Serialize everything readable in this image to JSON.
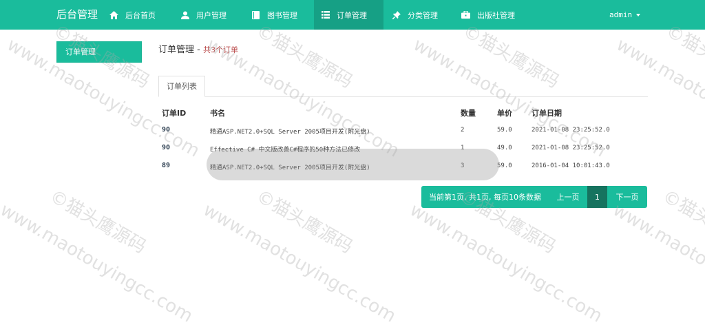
{
  "navbar": {
    "brand": "后台管理",
    "items": [
      {
        "label": "后台首页",
        "icon": "home-icon"
      },
      {
        "label": "用户管理",
        "icon": "user-icon"
      },
      {
        "label": "图书管理",
        "icon": "book-icon"
      },
      {
        "label": "订单管理",
        "icon": "list-icon"
      },
      {
        "label": "分类管理",
        "icon": "pushpin-icon"
      },
      {
        "label": "出版社管理",
        "icon": "briefcase-icon"
      }
    ],
    "user": "admin"
  },
  "sidebar": {
    "items": [
      {
        "label": "订单管理"
      }
    ]
  },
  "page": {
    "title": "订单管理 - ",
    "count": "共3个订单"
  },
  "tabs": [
    {
      "label": "订单列表"
    }
  ],
  "table": {
    "headers": [
      "订单ID",
      "书名",
      "数量",
      "单价",
      "订单日期"
    ],
    "rows": [
      {
        "id": "90",
        "name": "精通ASP.NET2.0+SQL Server 2005项目开发(附光盘)",
        "qty": "2",
        "price": "59.0",
        "date": "2021-01-08 23:25:52.0"
      },
      {
        "id": "90",
        "name": "Effective C# 中文版改善C#程序的50种方法已修改",
        "qty": "1",
        "price": "49.0",
        "date": "2021-01-08 23:25:52.0"
      },
      {
        "id": "89",
        "name": "精通ASP.NET2.0+SQL Server 2005项目开发(附光盘)",
        "qty": "3",
        "price": "59.0",
        "date": "2016-01-04 10:01:43.0"
      }
    ]
  },
  "pagination": {
    "info": "当前第1页, 共1页, 每页10条数据",
    "prev": "上一页",
    "current": "1",
    "next": "下一页"
  },
  "watermark": {
    "site": "www.maotouyingcc.com",
    "mark": "©猫头鹰源码"
  },
  "colors": {
    "primary": "#1abc9c",
    "primary_dark": "#16a085",
    "pager_active": "#16735f",
    "accent_text": "#b84646"
  }
}
